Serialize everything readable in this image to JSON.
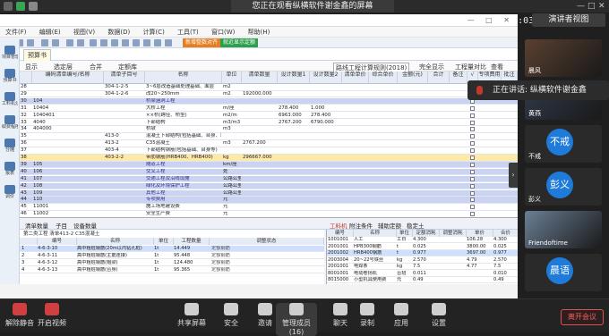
{
  "meeting": {
    "sharing_banner": "您正在观看纵横软件谢金鑫的屏幕",
    "timer": "01:38:03",
    "view_button": "演讲者视图",
    "speaker_popup": "正在讲话: 纵横软件谢金鑫",
    "leave_button": "离开会议"
  },
  "participants": [
    {
      "name": "晨风",
      "type": "camera"
    },
    {
      "name": "黄燕",
      "type": "camera"
    },
    {
      "name": "不戒",
      "type": "avatar",
      "initials": "不戒",
      "color": "#1e7bd9"
    },
    {
      "name": "彭义",
      "type": "avatar",
      "initials": "彭义",
      "color": "#1e7bd9"
    },
    {
      "name": "Friendoftime",
      "type": "camera"
    },
    {
      "name": "",
      "type": "avatar",
      "initials": "晨语",
      "color": "#1e7bd9"
    }
  ],
  "controls": [
    {
      "label": "解除静音",
      "icon": "mic-muted-icon"
    },
    {
      "label": "开启视频",
      "icon": "camera-off-icon"
    },
    {
      "label": "共享屏幕",
      "icon": "share-screen-icon"
    },
    {
      "label": "安全",
      "icon": "shield-icon"
    },
    {
      "label": "邀请",
      "icon": "invite-icon"
    },
    {
      "label": "管理成员(16)",
      "icon": "members-icon"
    },
    {
      "label": "聊天",
      "icon": "chat-icon"
    },
    {
      "label": "录制",
      "icon": "record-icon"
    },
    {
      "label": "应用",
      "icon": "apps-icon"
    },
    {
      "label": "设置",
      "icon": "gear-icon"
    }
  ],
  "app": {
    "menu": [
      "文件(F)",
      "编辑(E)",
      "视图(V)",
      "数据(D)",
      "计算(C)",
      "工具(T)",
      "窗口(W)",
      "帮助(H)"
    ],
    "badges": [
      {
        "text": "新增整数对齐",
        "color": "#e67e22"
      },
      {
        "text": "就近显示定额",
        "color": "#2e9f4a"
      }
    ],
    "tabs": [
      "项目管理",
      "预算书",
      "工料机汇总",
      "取费程序",
      "分摊",
      "报表",
      "调价"
    ],
    "active_tab": "预算书",
    "subbar": [
      "显示",
      "选定层",
      "合并",
      "定额库",
      "完全显示",
      "工程量对比",
      "按标准",
      "查看",
      "设置"
    ],
    "dropdown": "路线工程计算规则(2018)",
    "columns": [
      "编码清单编号/名称",
      "清单子目号",
      "名称",
      "单位",
      "清单数量",
      "设计数量1",
      "设计数量2",
      "清单单价",
      "综合单价",
      "金额(元)",
      "合计",
      "备注",
      "√",
      "专项费用",
      "批注"
    ],
    "rows": [
      {
        "no": "28",
        "code": "",
        "code2": "304-1-2-5",
        "name": "3~6层改造基础处理基础、面层",
        "unit": "m2",
        "q1": "",
        "q2": "",
        "q3": "",
        "style": "plain"
      },
      {
        "no": "29",
        "code": "",
        "code2": "304-1-2-6",
        "name": "改20~250mm",
        "unit": "m2",
        "q1": "192000.000",
        "q2": "",
        "q3": "",
        "style": "plain"
      },
      {
        "no": "30",
        "code": "104",
        "code2": "",
        "name": "桥梁涵洞工程",
        "unit": "",
        "q1": "",
        "q2": "",
        "q3": "",
        "style": "hl"
      },
      {
        "no": "31",
        "code": "10404",
        "code2": "",
        "name": "大桥工程",
        "unit": "m/座",
        "q1": "",
        "q2": "278.400",
        "q3": "1.000",
        "style": "plain"
      },
      {
        "no": "32",
        "code": "1040401",
        "code2": "",
        "name": "××桥(跨径、桥型)",
        "unit": "m2/m",
        "q1": "",
        "q2": "6963.000",
        "q3": "278.400",
        "style": "plain"
      },
      {
        "no": "33",
        "code": "4040",
        "code2": "",
        "name": "下部结构",
        "unit": "m3/m3",
        "q1": "",
        "q2": "2767.200",
        "q3": "6790.000",
        "style": "plain"
      },
      {
        "no": "34",
        "code": "404000",
        "code2": "",
        "name": "桥墩",
        "unit": "m3",
        "q1": "",
        "q2": "",
        "q3": "",
        "style": "plain"
      },
      {
        "no": "35",
        "code": "",
        "code2": "413-0",
        "name": "混凝土下部结构(包括基础、台身、墩身、帽梁等)",
        "unit": "",
        "q1": "",
        "q2": "",
        "q3": "",
        "style": "plain"
      },
      {
        "no": "36",
        "code": "",
        "code2": "413-2",
        "name": "C35混凝土",
        "unit": "m3",
        "q1": "2767.200",
        "q2": "",
        "q3": "",
        "style": "plain"
      },
      {
        "no": "37",
        "code": "",
        "code2": "403-4",
        "name": "下部结构钢筋(包括基础、台身等)",
        "unit": "",
        "q1": "",
        "q2": "",
        "q3": "",
        "style": "plain"
      },
      {
        "no": "38",
        "code": "",
        "code2": "403-2-2",
        "name": "带肋钢筋(HRB400、HRB400)",
        "unit": "kg",
        "q1": "296667.000",
        "q2": "",
        "q3": "",
        "style": "sel"
      },
      {
        "no": "39",
        "code": "105",
        "code2": "",
        "name": "隧道工程",
        "unit": "km/座",
        "q1": "",
        "q2": "",
        "q3": "",
        "style": "hl"
      },
      {
        "no": "40",
        "code": "106",
        "code2": "",
        "name": "交叉工程",
        "unit": "处",
        "q1": "",
        "q2": "",
        "q3": "",
        "style": "hl"
      },
      {
        "no": "41",
        "code": "107",
        "code2": "",
        "name": "交通工程及沿线设施",
        "unit": "公路公里",
        "q1": "",
        "q2": "",
        "q3": "",
        "style": "hl"
      },
      {
        "no": "42",
        "code": "108",
        "code2": "",
        "name": "绿化及环境保护工程",
        "unit": "公路公里",
        "q1": "",
        "q2": "",
        "q3": "",
        "style": "hl"
      },
      {
        "no": "43",
        "code": "109",
        "code2": "",
        "name": "其他工程",
        "unit": "公路公里",
        "q1": "",
        "q2": "",
        "q3": "",
        "style": "hl"
      },
      {
        "no": "44",
        "code": "110",
        "code2": "",
        "name": "专项费用",
        "unit": "元",
        "q1": "",
        "q2": "",
        "q3": "",
        "style": "hl"
      },
      {
        "no": "45",
        "code": "11001",
        "code2": "",
        "name": "施工场地建设费",
        "unit": "元",
        "q1": "",
        "q2": "",
        "q3": "",
        "style": "plain"
      },
      {
        "no": "46",
        "code": "11002",
        "code2": "",
        "name": "安全生产费",
        "unit": "元",
        "q1": "",
        "q2": "",
        "q3": "",
        "style": "plain"
      }
    ],
    "bottom_tabs": [
      "清单数量",
      "子目",
      "设备数量"
    ],
    "bottom_right_tabs": [
      "工料机",
      "附注条件",
      "辅助定额",
      "稳定土"
    ],
    "bottom_path": "第二类工程 清单413-2 C35混凝土",
    "quota_columns": [
      "编号",
      "名称",
      "单位",
      "工程数量",
      "调整状态"
    ],
    "quota_rows": [
      {
        "no": "1",
        "code": "4-6-3-10",
        "name": "高中粗桩钢筋(20m以内钻孔桩)",
        "unit": "1t",
        "qty": "14.449",
        "note": "定额钢筋"
      },
      {
        "no": "2",
        "code": "4-6-3-11",
        "name": "高中粗桩钢筋(主筋连接)",
        "unit": "1t",
        "qty": "95.448",
        "note": "定额钢筋"
      },
      {
        "no": "3",
        "code": "4-6-3-12",
        "name": "高中粗桩钢筋(帽梁)",
        "unit": "1t",
        "qty": "124.480",
        "note": "定额钢筋"
      },
      {
        "no": "4",
        "code": "4-6-3-13",
        "name": "高中粗桩钢筋(台身)",
        "unit": "1t",
        "qty": "95.365",
        "note": "定额钢筋"
      }
    ],
    "res_columns": [
      "编号",
      "名称",
      "单位",
      "定额消耗",
      "调整消耗",
      "单价",
      "合价"
    ],
    "res_rows": [
      {
        "code": "1001001",
        "name": "人工",
        "unit": "工日",
        "v1": "4.300",
        "v2": "106.28",
        "v3": "4.300"
      },
      {
        "code": "2001001",
        "name": "HPB300钢筋",
        "unit": "t",
        "v1": "0.025",
        "v2": "3800.00",
        "v3": "0.025"
      },
      {
        "code": "2001002",
        "name": "HRB400钢筋",
        "unit": "t",
        "v1": "0.977",
        "v2": "3697.00",
        "v3": "0.977"
      },
      {
        "code": "2003004",
        "name": "20~22号铁丝",
        "unit": "kg",
        "v1": "2.570",
        "v2": "4.79",
        "v3": "2.570"
      },
      {
        "code": "2001001",
        "name": "电焊条",
        "unit": "kg",
        "v1": "7.5",
        "v2": "4.77",
        "v3": "7.5"
      },
      {
        "code": "8001001",
        "name": "电动卷扬机",
        "unit": "台班",
        "v1": "0.011",
        "v2": "",
        "v3": "0.010"
      },
      {
        "code": "8015000",
        "name": "小型机具使用费",
        "unit": "元",
        "v1": "0.49",
        "v2": "",
        "v3": "0.49"
      }
    ]
  }
}
